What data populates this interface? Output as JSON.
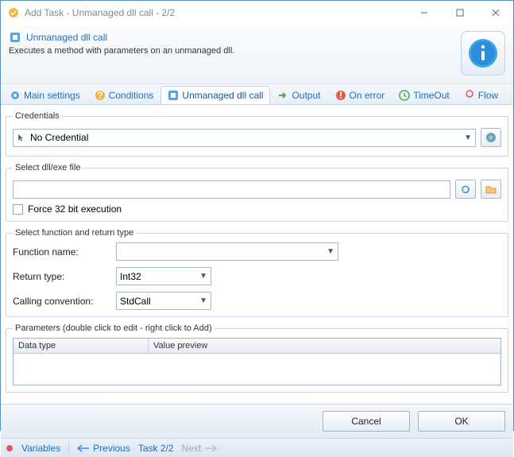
{
  "window": {
    "title": "Add Task - Unmanaged dll call - 2/2"
  },
  "header": {
    "title": "Unmanaged dll call",
    "description": "Executes a method with parameters on an unmanaged dll."
  },
  "tabs": [
    {
      "label": "Main settings"
    },
    {
      "label": "Conditions"
    },
    {
      "label": "Unmanaged dll call",
      "active": true
    },
    {
      "label": "Output"
    },
    {
      "label": "On error"
    },
    {
      "label": "TimeOut"
    },
    {
      "label": "Flow"
    }
  ],
  "credentials": {
    "legend": "Credentials",
    "value": "No Credential"
  },
  "dll": {
    "legend": "Select dll/exe file",
    "path": "",
    "force32_label": "Force 32 bit execution",
    "force32_checked": false
  },
  "func": {
    "legend": "Select function and return type",
    "function_label": "Function name:",
    "function_value": "",
    "return_label": "Return type:",
    "return_value": "Int32",
    "cc_label": "Calling convention:",
    "cc_value": "StdCall"
  },
  "params": {
    "legend": "Parameters (double click to edit - right click to Add)",
    "col1": "Data type",
    "col2": "Value preview",
    "rows": []
  },
  "footer": {
    "cancel": "Cancel",
    "ok": "OK"
  },
  "status": {
    "variables": "Variables",
    "previous": "Previous",
    "task": "Task 2/2",
    "next": "Next"
  }
}
